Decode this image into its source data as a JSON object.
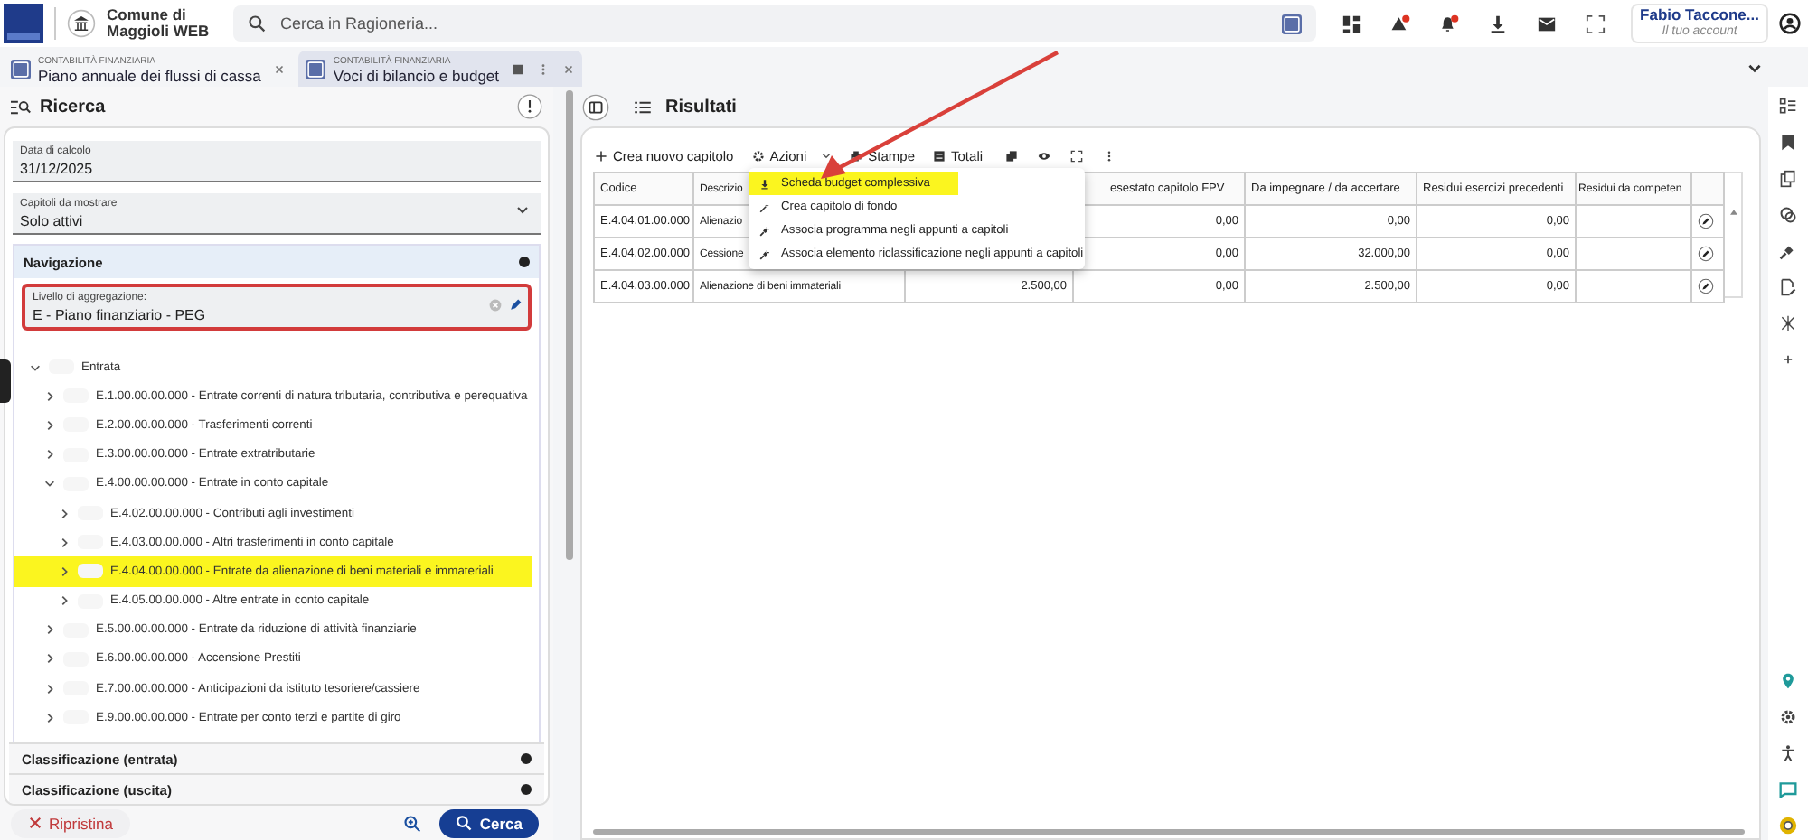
{
  "header": {
    "org_line1": "Comune di",
    "org_line2": "Maggioli WEB",
    "search": {
      "placeholder": "Cerca in Ragioneria..."
    },
    "user": {
      "name": "Fabio Taccone...",
      "subtitle": "Il tuo account"
    }
  },
  "tabs": [
    {
      "module": "CONTABILITÀ FINANZIARIA",
      "title": "Piano annuale dei flussi di cassa",
      "selected": false
    },
    {
      "module": "CONTABILITÀ FINANZIARIA",
      "title": "Voci di bilancio e budget",
      "selected": true
    }
  ],
  "search_panel": {
    "title": "Ricerca",
    "fields": [
      {
        "label": "Data di calcolo",
        "value": "31/12/2025",
        "kind": "text"
      },
      {
        "label": "Capitoli da mostrare",
        "value": "Solo attivi",
        "kind": "select"
      }
    ],
    "navigation": {
      "title": "Navigazione",
      "aggregation": {
        "label": "Livello di aggregazione:",
        "value": "E - Piano finanziario - PEG"
      },
      "tree": [
        {
          "label": "Entrata",
          "expanded": true,
          "highlighted": false,
          "children": [
            {
              "label": "E.1.00.00.00.000 - Entrate correnti di natura tributaria, contributiva e perequativa",
              "expanded": false,
              "highlighted": false
            },
            {
              "label": "E.2.00.00.00.000 - Trasferimenti correnti",
              "expanded": false,
              "highlighted": false
            },
            {
              "label": "E.3.00.00.00.000 - Entrate extratributarie",
              "expanded": false,
              "highlighted": false
            },
            {
              "label": "E.4.00.00.00.000 - Entrate in conto capitale",
              "expanded": true,
              "highlighted": false,
              "children": [
                {
                  "label": "E.4.02.00.00.000 - Contributi agli investimenti",
                  "expanded": false,
                  "highlighted": false
                },
                {
                  "label": "E.4.03.00.00.000 - Altri trasferimenti in conto capitale",
                  "expanded": false,
                  "highlighted": false
                },
                {
                  "label": "E.4.04.00.00.000 - Entrate da alienazione di beni materiali e immateriali",
                  "expanded": false,
                  "highlighted": true
                },
                {
                  "label": "E.4.05.00.00.000 - Altre entrate in conto capitale",
                  "expanded": false,
                  "highlighted": false
                }
              ]
            },
            {
              "label": "E.5.00.00.00.000 - Entrate da riduzione di attività finanziarie",
              "expanded": false,
              "highlighted": false
            },
            {
              "label": "E.6.00.00.00.000 - Accensione Prestiti",
              "expanded": false,
              "highlighted": false
            },
            {
              "label": "E.7.00.00.00.000 - Anticipazioni da istituto tesoriere/cassiere",
              "expanded": false,
              "highlighted": false
            },
            {
              "label": "E.9.00.00.00.000 - Entrate per conto terzi e partite di giro",
              "expanded": false,
              "highlighted": false
            }
          ]
        }
      ]
    },
    "sections": [
      {
        "title": "Classificazione (entrata)"
      },
      {
        "title": "Classificazione (uscita)"
      }
    ],
    "buttons": {
      "reset": "Ripristina",
      "search": "Cerca"
    }
  },
  "results": {
    "title": "Risultati",
    "toolbar": [
      {
        "label": "Crea nuovo capitolo",
        "kind": "add"
      },
      {
        "label": "Azioni",
        "kind": "menu"
      },
      {
        "label": "Stampe",
        "kind": "print"
      },
      {
        "label": "Totali",
        "kind": "totals"
      }
    ],
    "columns": {
      "codice": "Codice",
      "descrizione": "Descrizio",
      "fpv": "esestato capitolo FPV",
      "da_impegnare": "Da impegnare / da accertare",
      "residui_prec": "Residui esercizi precedenti",
      "residui_comp": "Residui da competen"
    },
    "rows": [
      {
        "codice": "E.4.04.01.00.000",
        "descrizione": "Alienazio",
        "fpv": "0,00",
        "da_impegnare": "0,00",
        "residui_prec": "0,00"
      },
      {
        "codice": "E.4.04.02.00.000",
        "descrizione": "Cessione",
        "fpv": "0,00",
        "da_impegnare": "32.000,00",
        "residui_prec": "0,00"
      },
      {
        "codice": "E.4.04.03.00.000",
        "descrizione": "Alienazione di beni immateriali",
        "col3": "2.500,00",
        "fpv": "0,00",
        "da_impegnare": "2.500,00",
        "residui_prec": "0,00"
      }
    ],
    "menu": [
      {
        "label": "Scheda budget complessiva",
        "kind": "download",
        "highlighted": true
      },
      {
        "label": "Crea capitolo di fondo",
        "kind": "wand",
        "highlighted": false
      },
      {
        "label": "Associa programma negli appunti a capitoli",
        "kind": "link",
        "highlighted": false
      },
      {
        "label": "Associa elemento riclassificazione negli appunti a capitoli",
        "kind": "link",
        "highlighted": false
      }
    ]
  }
}
